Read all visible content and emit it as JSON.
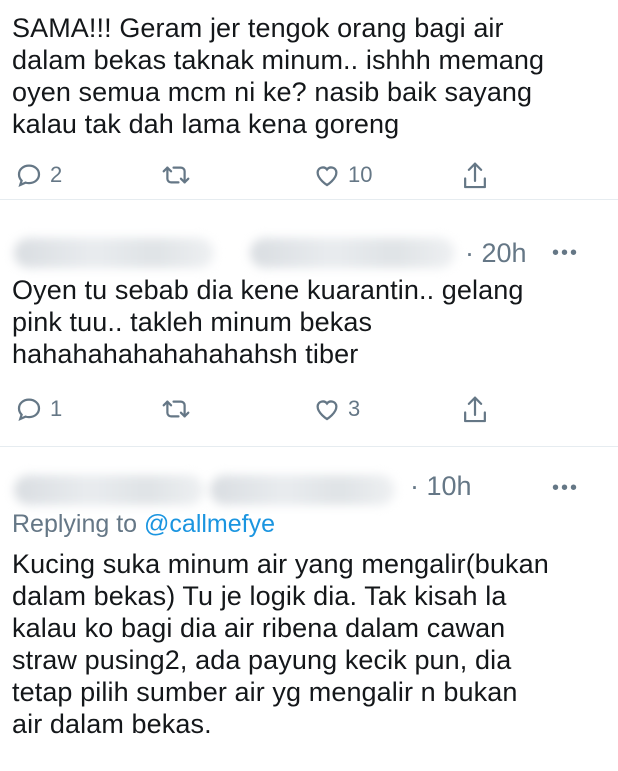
{
  "tweets": [
    {
      "text": "SAMA!!!  Geram jer tengok orang bagi air\ndalam bekas taknak minum.. ishhh memang\noyen semua mcm ni ke?  nasib baik sayang\nkalau tak dah lama kena goreng",
      "replies": "2",
      "likes": "10"
    },
    {
      "time": "· 20h",
      "more": "•••",
      "text": "Oyen tu sebab dia kene kuarantin.. gelang\npink tuu.. takleh minum bekas\nhahahahahahahahahsh tiber",
      "replies": "1",
      "likes": "3"
    },
    {
      "time": "· 10h",
      "more": "•••",
      "replying_prefix": "Replying to ",
      "replying_handle": "@callmefye",
      "text": "Kucing suka minum air yang mengalir(bukan\ndalam bekas) Tu je logik dia. Tak kisah la\nkalau ko bagi dia air ribena dalam cawan\nstraw pusing2, ada payung kecik pun, dia\ntetap pilih sumber air yg mengalir n bukan\nair dalam bekas."
    }
  ],
  "icons": {
    "reply": "reply-bubble-icon",
    "retweet": "retweet-icon",
    "like": "heart-icon",
    "share": "share-icon",
    "more": "more-dots-icon"
  },
  "colors": {
    "text": "#14171a",
    "secondary": "#657786",
    "link": "#1b95e0",
    "divider": "#e6ecf0"
  }
}
